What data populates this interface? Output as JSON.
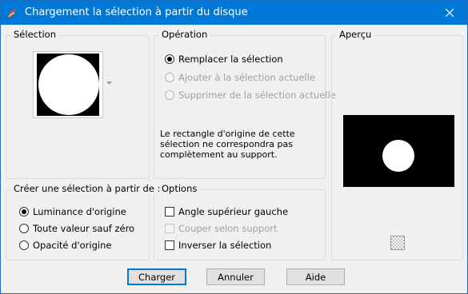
{
  "window": {
    "title": "Chargement la sélection à partir du disque"
  },
  "selection": {
    "legend": "Sélection",
    "dropdown_icon": "chevron-down-icon"
  },
  "operation": {
    "legend": "Opération",
    "options": [
      {
        "label": "Remplacer la sélection",
        "checked": true,
        "enabled": true
      },
      {
        "label": "Ajouter à la sélection actuelle",
        "checked": false,
        "enabled": false
      },
      {
        "label": "Supprimer de la sélection actuelle",
        "checked": false,
        "enabled": false
      }
    ],
    "note_line1": "Le rectangle d'origine de cette",
    "note_line2": "sélection ne correspondra pas",
    "note_line3": "complètement au support."
  },
  "preview": {
    "legend": "Aperçu",
    "toggle_icon": "checkerboard-icon"
  },
  "create_from": {
    "legend": "Créer une sélection à partir de :",
    "options": [
      {
        "label": "Luminance d'origine",
        "checked": true
      },
      {
        "label": "Toute valeur sauf zéro",
        "checked": false
      },
      {
        "label": "Opacité d'origine",
        "checked": false
      }
    ]
  },
  "options": {
    "legend": "Options",
    "items": [
      {
        "label": "Angle supérieur gauche",
        "checked": false,
        "enabled": true
      },
      {
        "label": "Couper selon support",
        "checked": false,
        "enabled": false
      },
      {
        "label": "Inverser la sélection",
        "checked": false,
        "enabled": true
      }
    ]
  },
  "buttons": {
    "load": "Charger",
    "cancel": "Annuler",
    "help": "Aide"
  },
  "colors": {
    "titlebar": "#0078d7",
    "accent": "#0078d7",
    "background": "#f0f0f0"
  }
}
